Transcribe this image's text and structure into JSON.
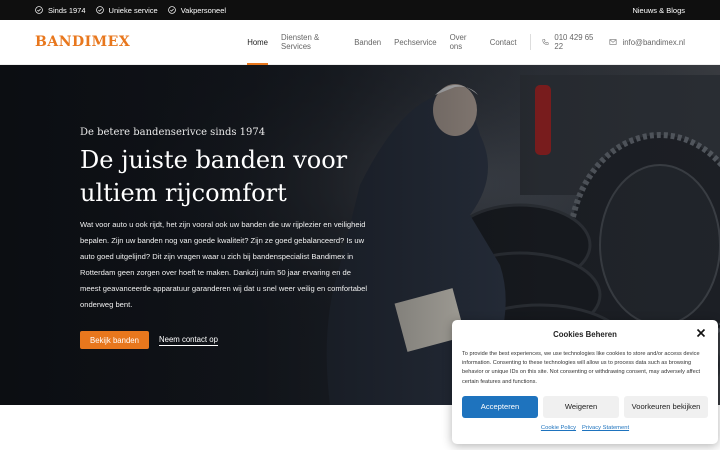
{
  "topbar": {
    "usps": [
      "Sinds 1974",
      "Unieke service",
      "Vakpersoneel"
    ],
    "news_link": "Nieuws & Blogs"
  },
  "header": {
    "logo": "BANDIMEX",
    "nav": [
      "Home",
      "Diensten & Services",
      "Banden",
      "Pechservice",
      "Over ons",
      "Contact"
    ],
    "active_nav": "Home",
    "phone": "010 429 65 22",
    "email": "info@bandimex.nl"
  },
  "hero": {
    "subtitle": "De betere bandenserivce sinds 1974",
    "title": "De juiste banden voor ultiem rijcomfort",
    "intro": "Wat voor auto u ook rijdt, het zijn vooral ook uw banden die uw rijplezier en veiligheid bepalen. Zijn uw banden nog van goede kwaliteit? Zijn ze goed gebalanceerd? Is uw auto goed uitgelijnd? Dit zijn vragen waar u zich bij bandenspecialist Bandimex in Rotterdam geen zorgen over hoeft te maken. Dankzij ruim 50 jaar ervaring en de meest geavanceerde apparatuur garanderen wij dat u snel weer veilig en comfortabel onderweg bent.",
    "primary_button": "Bekijk banden",
    "secondary_link": "Neem contact op"
  },
  "cookie": {
    "title": "Cookies Beheren",
    "text": "To provide the best experiences, we use technologies like cookies to store and/or access device information. Consenting to these technologies will allow us to process data such as browsing behavior or unique IDs on this site. Not consenting or withdrawing consent, may adversely affect certain features and functions.",
    "accept": "Accepteren",
    "deny": "Weigeren",
    "preferences": "Voorkeuren bekijken",
    "cookie_policy": "Cookie Policy",
    "privacy_statement": "Privacy Statement"
  },
  "colors": {
    "accent": "#e8771d",
    "dark": "#0f0f0f",
    "cookie_primary": "#1e73be"
  }
}
